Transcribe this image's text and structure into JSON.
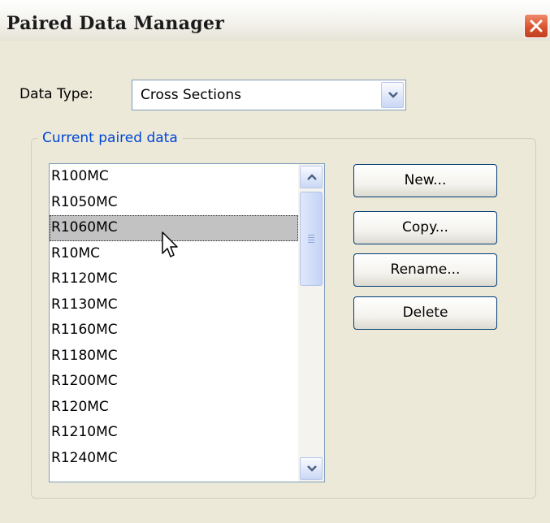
{
  "window": {
    "title": "Paired Data Manager"
  },
  "data_type": {
    "label": "Data Type:",
    "value": "Cross Sections"
  },
  "current_paired_data": {
    "label": "Current paired data",
    "items": [
      "R100MC",
      "R1050MC",
      "R1060MC",
      "R10MC",
      "R1120MC",
      "R1130MC",
      "R1160MC",
      "R1180MC",
      "R1200MC",
      "R120MC",
      "R1210MC",
      "R1240MC"
    ],
    "selected": "R1060MC"
  },
  "buttons": {
    "new": "New...",
    "copy": "Copy...",
    "rename": "Rename...",
    "delete": "Delete"
  },
  "icons": {
    "close": "close-icon",
    "dropdown": "chevron-down-icon",
    "scroll_up": "chevron-up-icon",
    "scroll_down": "chevron-down-icon",
    "cursor": "mouse-pointer-icon"
  },
  "colors": {
    "window_bg": "#ece9d8",
    "group_label": "#0046d5",
    "close_button": "#d8502c",
    "selection": "#c2c2c2"
  }
}
